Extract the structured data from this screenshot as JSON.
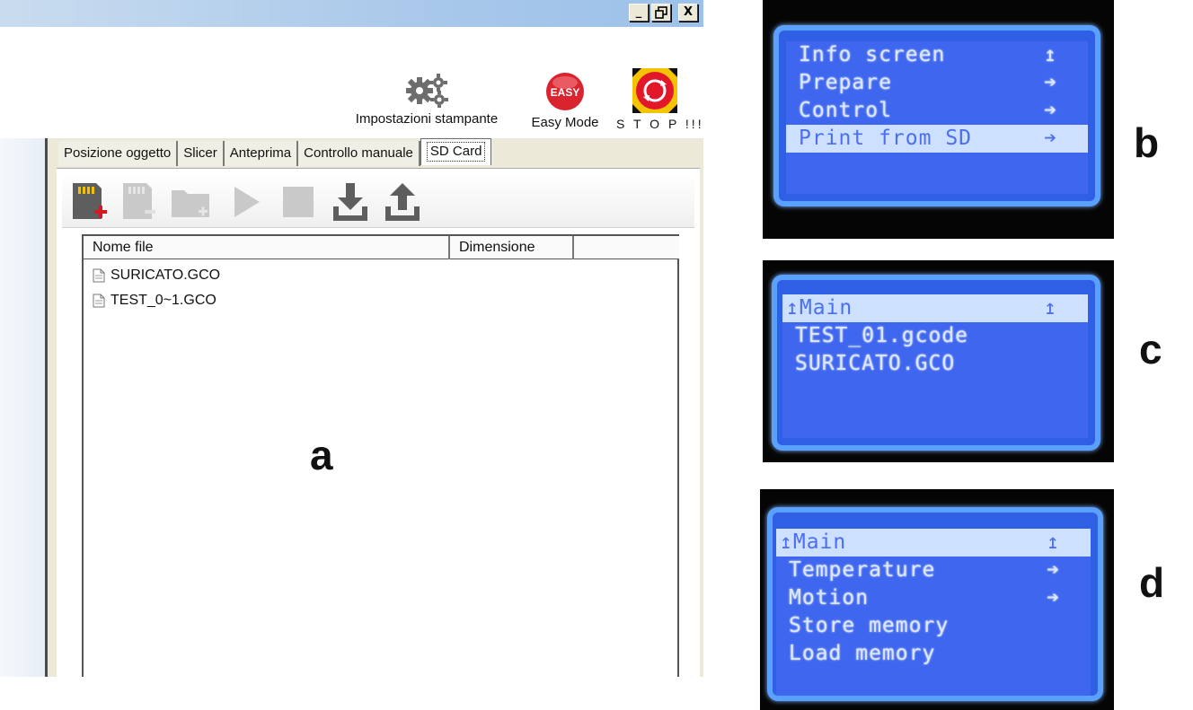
{
  "window": {
    "minimize": "_",
    "maximize": "🗗",
    "close": "X"
  },
  "toolbar": {
    "settings_label": "Impostazioni stampante",
    "easy_label": "Easy Mode",
    "easy_badge": "EASY",
    "stop_label": "S T O P !!!"
  },
  "tabs": [
    {
      "label": "Posizione oggetto"
    },
    {
      "label": "Slicer"
    },
    {
      "label": "Anteprima"
    },
    {
      "label": "Controllo manuale"
    },
    {
      "label": "SD Card",
      "active": true
    }
  ],
  "sd_toolbar": {
    "icons": [
      "sd-add-icon",
      "sd-remove-icon",
      "new-folder-icon",
      "play-icon",
      "stop-icon",
      "download-icon",
      "upload-icon"
    ]
  },
  "file_table": {
    "columns": [
      "Nome file",
      "Dimensione",
      ""
    ],
    "rows": [
      {
        "name": "SURICATO.GCO"
      },
      {
        "name": "TEST_0~1.GCO"
      }
    ]
  },
  "labels": {
    "a": "a",
    "b": "b",
    "c": "c",
    "d": "d"
  },
  "lcd_b": {
    "lines": [
      {
        "text": "Info screen",
        "arrow": "↥",
        "selected": false
      },
      {
        "text": "Prepare",
        "arrow": "➔",
        "selected": false
      },
      {
        "text": "Control",
        "arrow": "➔",
        "selected": false
      },
      {
        "text": "Print from SD",
        "arrow": "➔",
        "selected": true
      }
    ]
  },
  "lcd_c": {
    "lines": [
      {
        "text": "↥Main",
        "arrow": "↥",
        "selected": true
      },
      {
        "text": "TEST_01.gcode",
        "arrow": "",
        "selected": false
      },
      {
        "text": "SURICATO.GCO",
        "arrow": "",
        "selected": false
      }
    ]
  },
  "lcd_d": {
    "lines": [
      {
        "text": "↥Main",
        "arrow": "↥",
        "selected": true
      },
      {
        "text": "Temperature",
        "arrow": "➔",
        "selected": false
      },
      {
        "text": "Motion",
        "arrow": "➔",
        "selected": false
      },
      {
        "text": "Store memory",
        "arrow": "",
        "selected": false
      },
      {
        "text": "Load memory",
        "arrow": "",
        "selected": false
      }
    ]
  },
  "colors": {
    "lcd_bg": "#3f66ee",
    "lcd_text": "#dbe7ff",
    "lcd_highlight": "#cde0ff",
    "easy_red": "#d9232e"
  }
}
